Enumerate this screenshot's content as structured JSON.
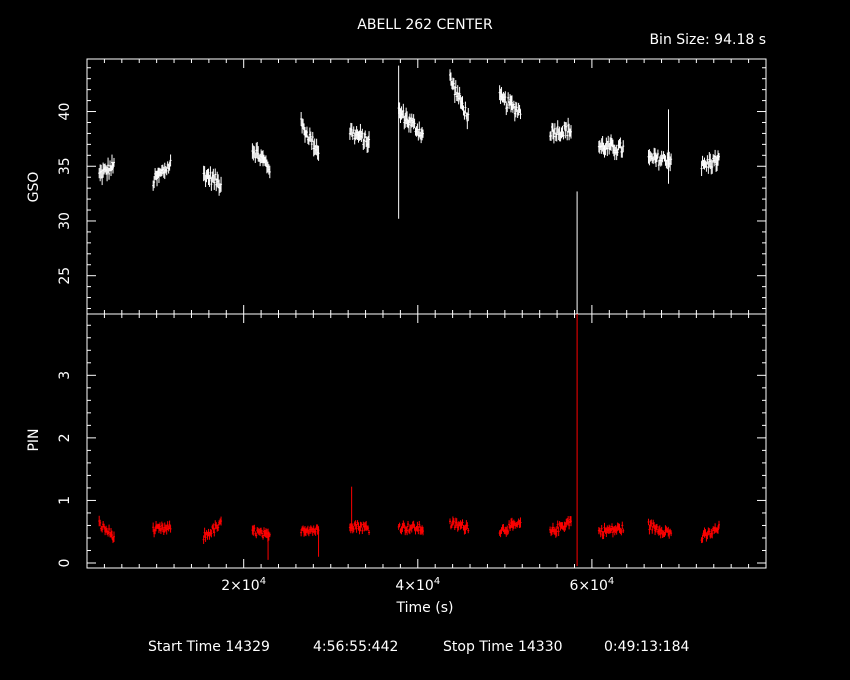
{
  "title": "ABELL 262 CENTER",
  "bin_size_label": "Bin Size: 94.18 s",
  "footer": {
    "start_label": "Start Time 14329",
    "start_value": "4:56:55:442",
    "stop_label": "Stop Time 14330",
    "stop_value": "0:49:13:184"
  },
  "colors": {
    "background": "#000000",
    "frame": "#ffffff",
    "gso": "#ffffff",
    "pin": "#ff0000"
  },
  "chart_data": [
    {
      "type": "scatter",
      "ylabel": "GSO",
      "xlim": [
        2000,
        80000
      ],
      "ylim": [
        21.5,
        44.8
      ],
      "yticks": [
        25,
        30,
        35,
        40
      ],
      "ytick_labels": [
        "25",
        "30",
        "35",
        "40"
      ],
      "color": "#ffffff",
      "segments": [
        {
          "x": [
            3400,
            5100
          ],
          "y": [
            34.2,
            35.0
          ]
        },
        {
          "x": [
            9600,
            11600
          ],
          "y": [
            33.6,
            35.2
          ]
        },
        {
          "x": [
            15400,
            17400
          ],
          "y": [
            34.3,
            33.4
          ]
        },
        {
          "x": [
            21000,
            23000
          ],
          "y": [
            36.6,
            34.9
          ]
        },
        {
          "x": [
            26600,
            28600
          ],
          "y": [
            38.8,
            36.4
          ]
        },
        {
          "x": [
            32200,
            34400
          ],
          "y": [
            38.2,
            37.2
          ]
        },
        {
          "x": [
            37800,
            40600
          ],
          "y": [
            40.0,
            37.9
          ]
        },
        {
          "x": [
            43700,
            45800
          ],
          "y": [
            43.0,
            39.4
          ]
        },
        {
          "x": [
            49400,
            51800
          ],
          "y": [
            41.2,
            40.0
          ]
        },
        {
          "x": [
            55200,
            57600
          ],
          "y": [
            38.2,
            38.3
          ]
        },
        {
          "x": [
            60800,
            63600
          ],
          "y": [
            36.8,
            36.6
          ]
        },
        {
          "x": [
            66500,
            69100
          ],
          "y": [
            35.6,
            35.7
          ]
        },
        {
          "x": [
            72600,
            74600
          ],
          "y": [
            35.0,
            35.6
          ]
        }
      ],
      "spikes": [
        {
          "x": 37800,
          "y_low": 30.2,
          "y_high": 44.2
        },
        {
          "x": 58300,
          "y_low": 21.5,
          "y_high": 32.7
        },
        {
          "x": 68800,
          "y_low": 33.4,
          "y_high": 40.2
        }
      ]
    },
    {
      "type": "scatter",
      "xlabel": "Time (s)",
      "ylabel": "PIN",
      "xlim": [
        2000,
        80000
      ],
      "ylim": [
        -0.08,
        3.98
      ],
      "yticks": [
        0,
        1,
        2,
        3
      ],
      "ytick_labels": [
        "0",
        "1",
        "2",
        "3"
      ],
      "xticks": [
        20000,
        40000,
        60000
      ],
      "xtick_labels": [
        "2×10^4",
        "4×10^4",
        "6×10^4"
      ],
      "color": "#ff0000",
      "segments": [
        {
          "x": [
            3400,
            5100
          ],
          "y": [
            0.62,
            0.42
          ]
        },
        {
          "x": [
            9600,
            11600
          ],
          "y": [
            0.52,
            0.55
          ]
        },
        {
          "x": [
            15400,
            17400
          ],
          "y": [
            0.42,
            0.62
          ]
        },
        {
          "x": [
            21000,
            23000
          ],
          "y": [
            0.52,
            0.4
          ]
        },
        {
          "x": [
            26600,
            28600
          ],
          "y": [
            0.55,
            0.52
          ]
        },
        {
          "x": [
            32200,
            34400
          ],
          "y": [
            0.62,
            0.55
          ]
        },
        {
          "x": [
            37800,
            40600
          ],
          "y": [
            0.58,
            0.55
          ]
        },
        {
          "x": [
            43700,
            45800
          ],
          "y": [
            0.62,
            0.58
          ]
        },
        {
          "x": [
            49400,
            51800
          ],
          "y": [
            0.52,
            0.62
          ]
        },
        {
          "x": [
            55200,
            57600
          ],
          "y": [
            0.48,
            0.68
          ]
        },
        {
          "x": [
            60800,
            63600
          ],
          "y": [
            0.5,
            0.55
          ]
        },
        {
          "x": [
            66500,
            69100
          ],
          "y": [
            0.6,
            0.48
          ]
        },
        {
          "x": [
            72600,
            74600
          ],
          "y": [
            0.4,
            0.55
          ]
        }
      ],
      "spikes": [
        {
          "x": 32400,
          "y_low": 0.55,
          "y_high": 1.22
        },
        {
          "x": 58300,
          "y_low": -0.05,
          "y_high": 3.98
        },
        {
          "x": 22800,
          "y_low": 0.05,
          "y_high": 0.55
        },
        {
          "x": 28600,
          "y_low": 0.1,
          "y_high": 0.55
        }
      ]
    }
  ]
}
